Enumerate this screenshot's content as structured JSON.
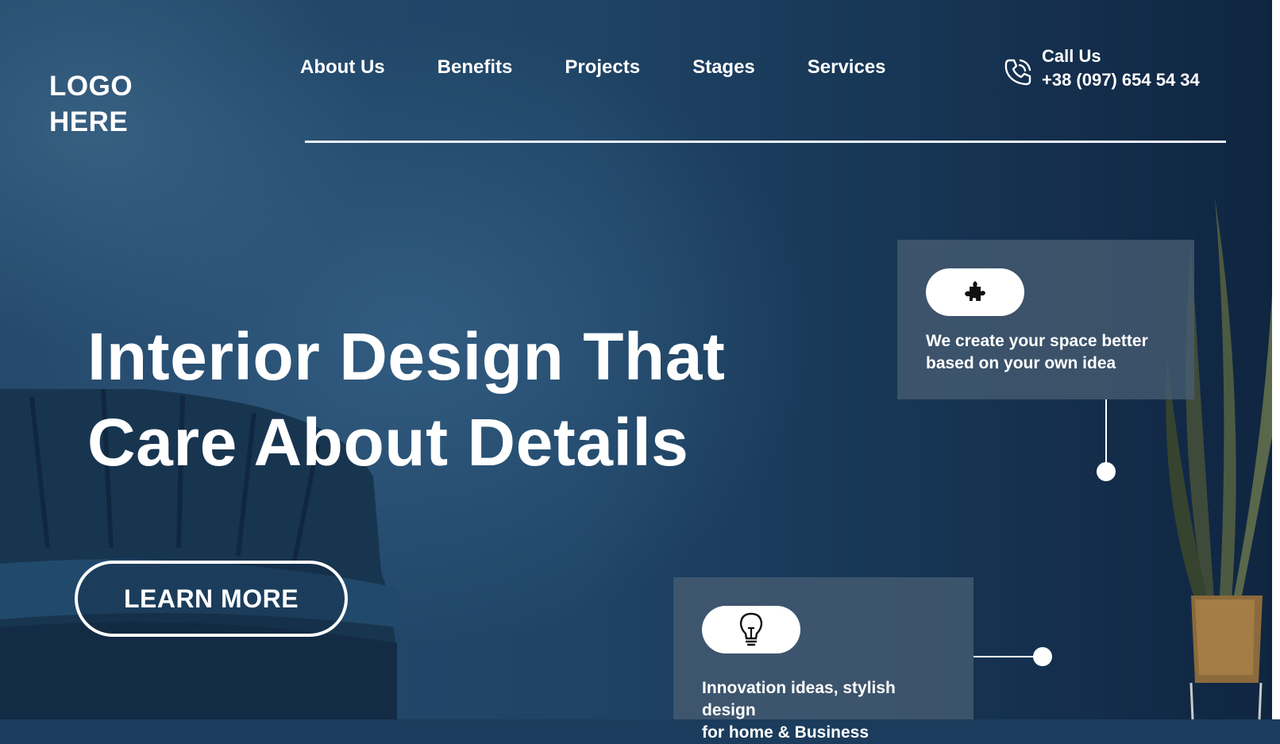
{
  "brand": {
    "logo_line1": "LOGO",
    "logo_line2": "HERE"
  },
  "nav": {
    "items": [
      {
        "label": "About Us"
      },
      {
        "label": "Benefits"
      },
      {
        "label": "Projects"
      },
      {
        "label": "Stages"
      },
      {
        "label": "Services"
      }
    ]
  },
  "contact": {
    "label": "Call Us",
    "phone": "+38 (097) 654 54 34",
    "icon": "phone-icon"
  },
  "hero": {
    "title_line1": "Interior Design That",
    "title_line2": "Care About Details",
    "cta_label": "LEARN MORE"
  },
  "features": [
    {
      "icon": "puzzle-icon",
      "text": "We create your space better based on your own idea"
    },
    {
      "icon": "lightbulb-icon",
      "text_line1": "Innovation ideas, stylish design",
      "text_line2": "for home & Business"
    }
  ],
  "colors": {
    "background": "#1f4466",
    "text": "#ffffff",
    "card": "#465c72"
  }
}
